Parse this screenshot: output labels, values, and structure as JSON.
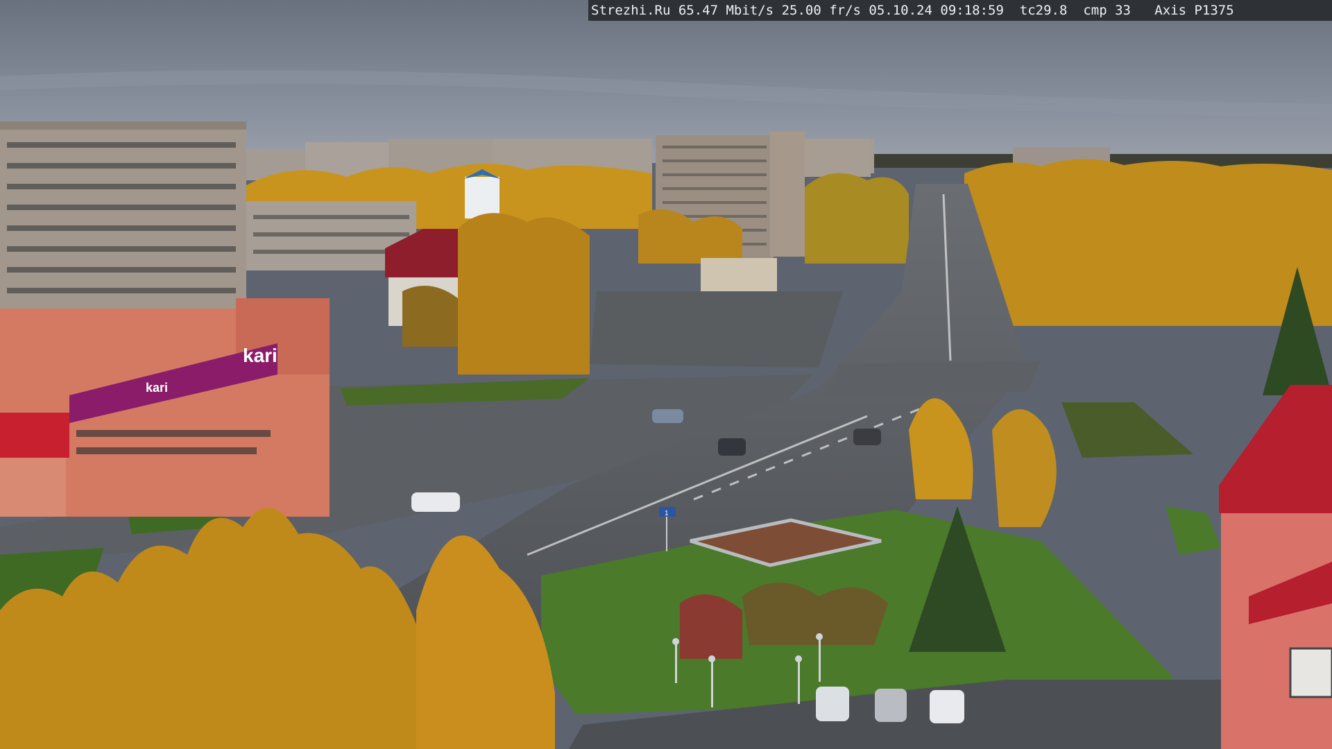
{
  "overlay": {
    "site": "Strezhi.Ru",
    "bitrate": "65.47 Mbit/s",
    "framerate": "25.00 fr/s",
    "date": "05.10.24",
    "time": "09:18:59",
    "tc": "tc29.8",
    "cmp": "cmp 33",
    "camera": "Axis P1375"
  },
  "signs": {
    "kari_main": "kari",
    "kari_small": "kari",
    "road_sign": "1"
  },
  "colors": {
    "sky": "#7d8594",
    "foliage": "#c9941e",
    "road": "#55585c",
    "grass": "#4a7a2a",
    "store_magenta": "#8a1c6a",
    "roof_red": "#b51f2e"
  }
}
